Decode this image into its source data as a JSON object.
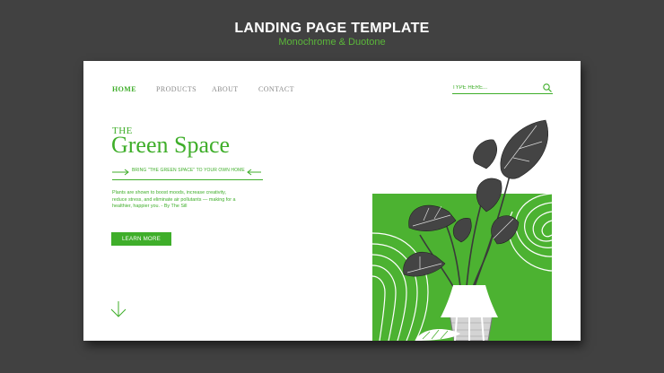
{
  "header": {
    "title": "LANDING PAGE TEMPLATE",
    "subtitle": "Monochrome & Duotone"
  },
  "nav": {
    "items": [
      {
        "label": "HOME",
        "active": true
      },
      {
        "label": "PRODUCTS",
        "active": false
      },
      {
        "label": "ABOUT",
        "active": false
      },
      {
        "label": "CONTACT",
        "active": false
      }
    ]
  },
  "search": {
    "placeholder": "TYPE HERE...",
    "icon": "search-icon"
  },
  "hero": {
    "small_title": "THE",
    "big_title": "Green Space",
    "tagline": "BRING \"THE GREEN SPACE\" TO YOUR OWN HOME",
    "description": "Plants are shown to boost moods, increase creativity, reduce stress, and eliminate air pollutants — making for a healthier, happier you. - By The Sill",
    "cta_label": "LEARN MORE",
    "scroll_icon": "arrow-down-icon"
  },
  "colors": {
    "background": "#414141",
    "accent": "#3fae2a",
    "panel": "#4cb231",
    "page": "#ffffff"
  }
}
